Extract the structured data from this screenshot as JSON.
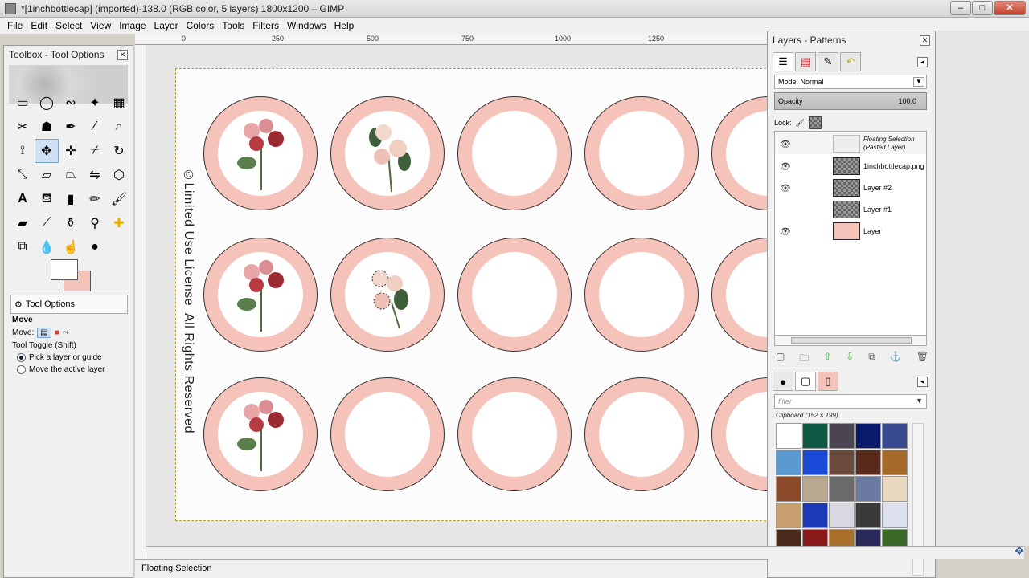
{
  "window": {
    "title": "*[1inchbottlecap] (imported)-138.0 (RGB color, 5 layers) 1800x1200 – GIMP"
  },
  "menu": [
    "File",
    "Edit",
    "Select",
    "View",
    "Image",
    "Layer",
    "Colors",
    "Tools",
    "Filters",
    "Windows",
    "Help"
  ],
  "ruler": {
    "ticks": [
      "0",
      "250",
      "500",
      "750",
      "1000",
      "1250"
    ]
  },
  "canvas": {
    "vertical_text_1": "©Limited Use License",
    "vertical_text_2": "All Rights Reserved"
  },
  "toolbox": {
    "title": "Toolbox - Tool Options",
    "tooloptions_tab": "Tool Options",
    "tool_name": "Move",
    "move_label": "Move:",
    "toggle_label": "Tool Toggle  (Shift)",
    "opt1": "Pick a layer or guide",
    "opt2": "Move the active layer"
  },
  "layers": {
    "title": "Layers - Patterns",
    "mode_label": "Mode:",
    "mode_value": "Normal",
    "opacity_label": "Opacity",
    "opacity_value": "100.0",
    "lock_label": "Lock:",
    "items": [
      {
        "name": "Floating Selection\n(Pasted Layer)",
        "line1": "Floating Selection",
        "line2": "(Pasted Layer)"
      },
      {
        "name": "1inchbottlecap.png"
      },
      {
        "name": "Layer #2"
      },
      {
        "name": "Layer #1"
      },
      {
        "name": "Layer"
      }
    ],
    "filter_placeholder": "filter",
    "clipboard_label": "Clipboard (152 × 199)"
  },
  "status": {
    "text": "Floating Selection"
  }
}
